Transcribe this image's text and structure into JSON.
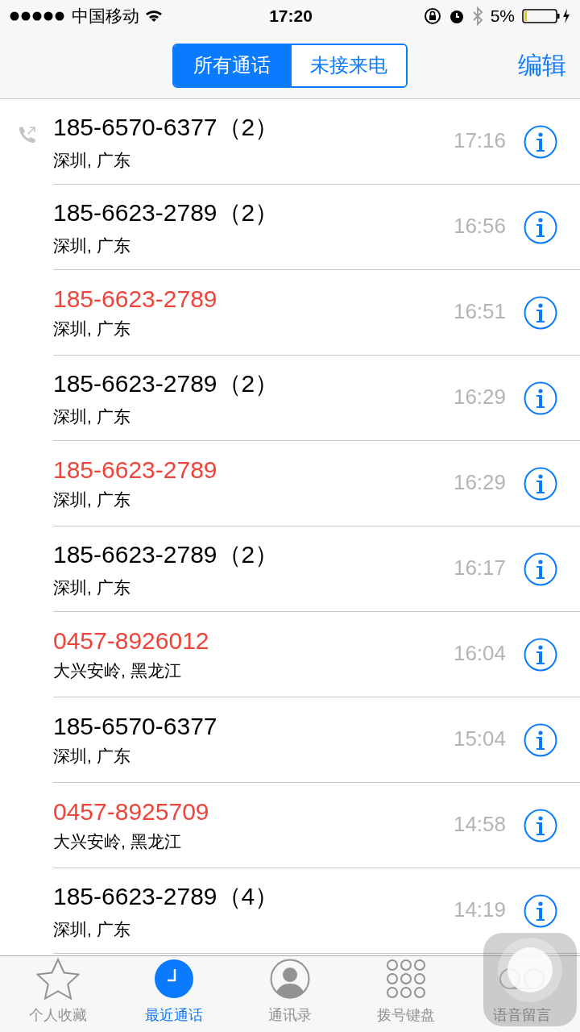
{
  "status_bar": {
    "carrier": "中国移动",
    "time": "17:20",
    "battery": "5%"
  },
  "segments": [
    {
      "label": "所有通话",
      "selected": true
    },
    {
      "label": "未接来电",
      "selected": false
    }
  ],
  "edit_button": "编辑",
  "calls": [
    {
      "number": "185-6570-6377（2）",
      "location": "深圳, 广东",
      "time": "17:16",
      "missed": false,
      "outgoing": true
    },
    {
      "number": "185-6623-2789（2）",
      "location": "深圳, 广东",
      "time": "16:56",
      "missed": false,
      "outgoing": false
    },
    {
      "number": "185-6623-2789",
      "location": "深圳, 广东",
      "time": "16:51",
      "missed": true,
      "outgoing": false
    },
    {
      "number": "185-6623-2789（2）",
      "location": "深圳, 广东",
      "time": "16:29",
      "missed": false,
      "outgoing": false
    },
    {
      "number": "185-6623-2789",
      "location": "深圳, 广东",
      "time": "16:29",
      "missed": true,
      "outgoing": false
    },
    {
      "number": "185-6623-2789（2）",
      "location": "深圳, 广东",
      "time": "16:17",
      "missed": false,
      "outgoing": false
    },
    {
      "number": "0457-8926012",
      "location": "大兴安岭, 黑龙江",
      "time": "16:04",
      "missed": true,
      "outgoing": false
    },
    {
      "number": "185-6570-6377",
      "location": "深圳, 广东",
      "time": "15:04",
      "missed": false,
      "outgoing": false
    },
    {
      "number": "0457-8925709",
      "location": "大兴安岭, 黑龙江",
      "time": "14:58",
      "missed": true,
      "outgoing": false
    },
    {
      "number": "185-6623-2789（4）",
      "location": "深圳, 广东",
      "time": "14:19",
      "missed": false,
      "outgoing": false
    }
  ],
  "tabs": [
    {
      "label": "个人收藏",
      "selected": false
    },
    {
      "label": "最近通话",
      "selected": true
    },
    {
      "label": "通讯录",
      "selected": false
    },
    {
      "label": "拨号键盘",
      "selected": false
    },
    {
      "label": "语音留言",
      "selected": false
    }
  ]
}
